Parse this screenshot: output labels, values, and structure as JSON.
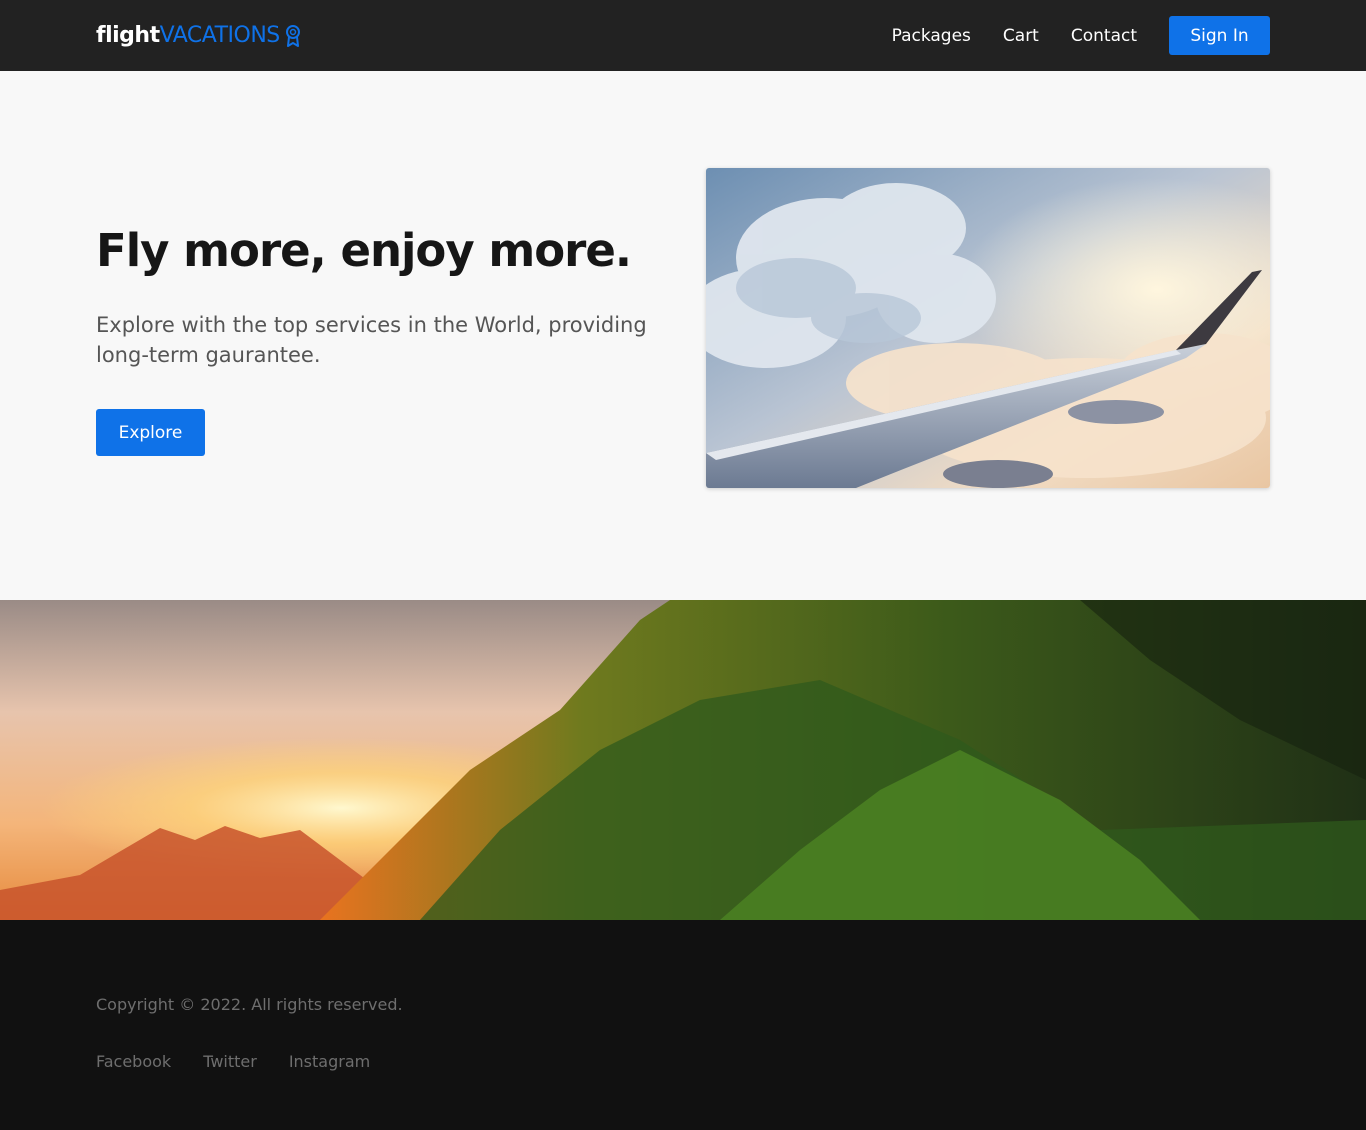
{
  "navbar": {
    "logo_primary": "flight",
    "logo_secondary": "VACATIONS",
    "logo_icon": "award-ribbon-icon",
    "links": [
      "Packages",
      "Cart",
      "Contact"
    ],
    "signin_label": "Sign In"
  },
  "hero": {
    "title": "Fly more, enjoy more.",
    "subtitle": "Explore with the top services in the World, providing long-term gaurantee.",
    "cta_label": "Explore"
  },
  "footer": {
    "copyright": "Copyright © 2022. All rights reserved.",
    "social_links": [
      "Facebook",
      "Twitter",
      "Instagram"
    ]
  },
  "colors": {
    "accent": "#0f72e8",
    "navbar_bg": "#222222",
    "footer_bg": "#111111",
    "page_bg": "#f8f8f8"
  }
}
